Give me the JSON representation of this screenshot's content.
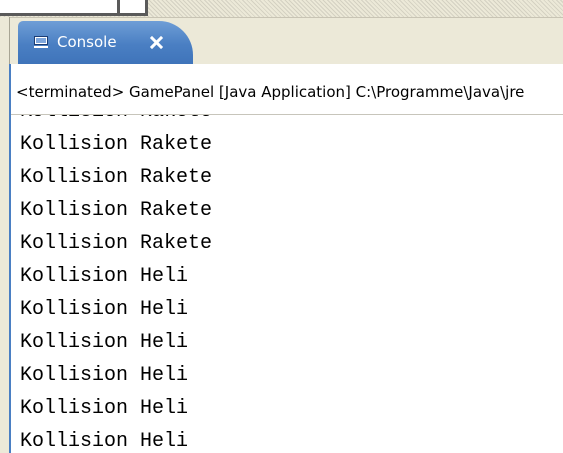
{
  "console_tab": {
    "icon": "console-icon",
    "label": "Console",
    "close_icon": "close-icon",
    "accent_color": "#4a7fc3"
  },
  "status": {
    "text": "<terminated> GamePanel [Java Application] C:\\Programme\\Java\\jre"
  },
  "output": {
    "lines": [
      "Kollision Rakete",
      "Kollision Rakete",
      "Kollision Rakete",
      "Kollision Rakete",
      "Kollision Rakete",
      "Kollision Heli",
      "Kollision Heli",
      "Kollision Heli",
      "Kollision Heli",
      "Kollision Heli",
      "Kollision Heli"
    ]
  }
}
